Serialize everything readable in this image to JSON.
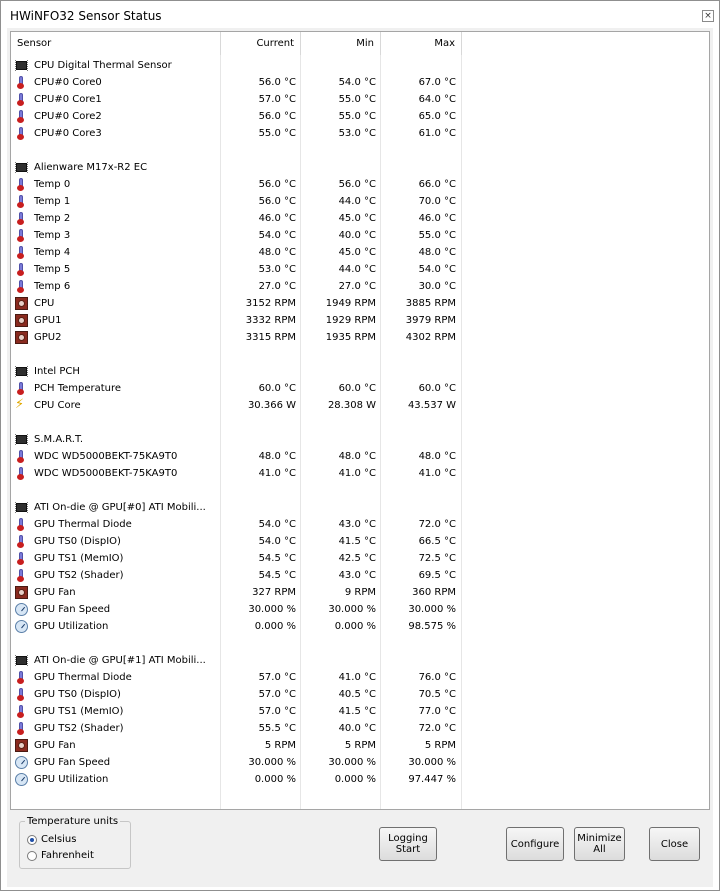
{
  "window": {
    "title": "HWiNFO32 Sensor Status",
    "close_glyph": "×"
  },
  "columns": {
    "sensor": "Sensor",
    "current": "Current",
    "min": "Min",
    "max": "Max"
  },
  "groups": [
    {
      "name": "CPU Digital Thermal Sensor",
      "rows": [
        {
          "icon": "thermometer",
          "name": "CPU#0 Core0",
          "current": "56.0 °C",
          "min": "54.0 °C",
          "max": "67.0 °C"
        },
        {
          "icon": "thermometer",
          "name": "CPU#0 Core1",
          "current": "57.0 °C",
          "min": "55.0 °C",
          "max": "64.0 °C"
        },
        {
          "icon": "thermometer",
          "name": "CPU#0 Core2",
          "current": "56.0 °C",
          "min": "55.0 °C",
          "max": "65.0 °C"
        },
        {
          "icon": "thermometer",
          "name": "CPU#0 Core3",
          "current": "55.0 °C",
          "min": "53.0 °C",
          "max": "61.0 °C"
        }
      ]
    },
    {
      "name": "Alienware M17x-R2 EC",
      "rows": [
        {
          "icon": "thermometer",
          "name": "Temp 0",
          "current": "56.0 °C",
          "min": "56.0 °C",
          "max": "66.0 °C"
        },
        {
          "icon": "thermometer",
          "name": "Temp 1",
          "current": "56.0 °C",
          "min": "44.0 °C",
          "max": "70.0 °C"
        },
        {
          "icon": "thermometer",
          "name": "Temp 2",
          "current": "46.0 °C",
          "min": "45.0 °C",
          "max": "46.0 °C"
        },
        {
          "icon": "thermometer",
          "name": "Temp 3",
          "current": "54.0 °C",
          "min": "40.0 °C",
          "max": "55.0 °C"
        },
        {
          "icon": "thermometer",
          "name": "Temp 4",
          "current": "48.0 °C",
          "min": "45.0 °C",
          "max": "48.0 °C"
        },
        {
          "icon": "thermometer",
          "name": "Temp 5",
          "current": "53.0 °C",
          "min": "44.0 °C",
          "max": "54.0 °C"
        },
        {
          "icon": "thermometer",
          "name": "Temp 6",
          "current": "27.0 °C",
          "min": "27.0 °C",
          "max": "30.0 °C"
        },
        {
          "icon": "fan",
          "name": "CPU",
          "current": "3152 RPM",
          "min": "1949 RPM",
          "max": "3885 RPM"
        },
        {
          "icon": "fan",
          "name": "GPU1",
          "current": "3332 RPM",
          "min": "1929 RPM",
          "max": "3979 RPM"
        },
        {
          "icon": "fan",
          "name": "GPU2",
          "current": "3315 RPM",
          "min": "1935 RPM",
          "max": "4302 RPM"
        }
      ]
    },
    {
      "name": "Intel PCH",
      "rows": [
        {
          "icon": "thermometer",
          "name": "PCH Temperature",
          "current": "60.0 °C",
          "min": "60.0 °C",
          "max": "60.0 °C"
        },
        {
          "icon": "bolt",
          "name": "CPU Core",
          "current": "30.366 W",
          "min": "28.308 W",
          "max": "43.537 W"
        }
      ]
    },
    {
      "name": "S.M.A.R.T.",
      "rows": [
        {
          "icon": "thermometer",
          "name": "WDC WD5000BEKT-75KA9T0",
          "current": "48.0 °C",
          "min": "48.0 °C",
          "max": "48.0 °C"
        },
        {
          "icon": "thermometer",
          "name": "WDC WD5000BEKT-75KA9T0",
          "current": "41.0 °C",
          "min": "41.0 °C",
          "max": "41.0 °C"
        }
      ]
    },
    {
      "name": "ATI On-die @ GPU[#0] ATI Mobili...",
      "rows": [
        {
          "icon": "thermometer",
          "name": "GPU Thermal Diode",
          "current": "54.0 °C",
          "min": "43.0 °C",
          "max": "72.0 °C"
        },
        {
          "icon": "thermometer",
          "name": "GPU TS0 (DispIO)",
          "current": "54.0 °C",
          "min": "41.5 °C",
          "max": "66.5 °C"
        },
        {
          "icon": "thermometer",
          "name": "GPU TS1 (MemIO)",
          "current": "54.5 °C",
          "min": "42.5 °C",
          "max": "72.5 °C"
        },
        {
          "icon": "thermometer",
          "name": "GPU TS2 (Shader)",
          "current": "54.5 °C",
          "min": "43.0 °C",
          "max": "69.5 °C"
        },
        {
          "icon": "fan",
          "name": "GPU Fan",
          "current": "327 RPM",
          "min": "9 RPM",
          "max": "360 RPM"
        },
        {
          "icon": "gauge",
          "name": "GPU Fan Speed",
          "current": "30.000 %",
          "min": "30.000 %",
          "max": "30.000 %"
        },
        {
          "icon": "gauge",
          "name": "GPU Utilization",
          "current": "0.000 %",
          "min": "0.000 %",
          "max": "98.575 %"
        }
      ]
    },
    {
      "name": "ATI On-die @ GPU[#1] ATI Mobili...",
      "rows": [
        {
          "icon": "thermometer",
          "name": "GPU Thermal Diode",
          "current": "57.0 °C",
          "min": "41.0 °C",
          "max": "76.0 °C"
        },
        {
          "icon": "thermometer",
          "name": "GPU TS0 (DispIO)",
          "current": "57.0 °C",
          "min": "40.5 °C",
          "max": "70.5 °C"
        },
        {
          "icon": "thermometer",
          "name": "GPU TS1 (MemIO)",
          "current": "57.0 °C",
          "min": "41.5 °C",
          "max": "77.0 °C"
        },
        {
          "icon": "thermometer",
          "name": "GPU TS2 (Shader)",
          "current": "55.5 °C",
          "min": "40.0 °C",
          "max": "72.0 °C"
        },
        {
          "icon": "fan",
          "name": "GPU Fan",
          "current": "5 RPM",
          "min": "5 RPM",
          "max": "5 RPM"
        },
        {
          "icon": "gauge",
          "name": "GPU Fan Speed",
          "current": "30.000 %",
          "min": "30.000 %",
          "max": "30.000 %"
        },
        {
          "icon": "gauge",
          "name": "GPU Utilization",
          "current": "0.000 %",
          "min": "0.000 %",
          "max": "97.447 %"
        }
      ]
    }
  ],
  "temperature_units": {
    "label": "Temperature units",
    "options": [
      "Celsius",
      "Fahrenheit"
    ],
    "selected": "Celsius"
  },
  "buttons": {
    "logging": "Logging\nStart",
    "configure": "Configure",
    "minimize": "Minimize\nAll",
    "close": "Close"
  }
}
